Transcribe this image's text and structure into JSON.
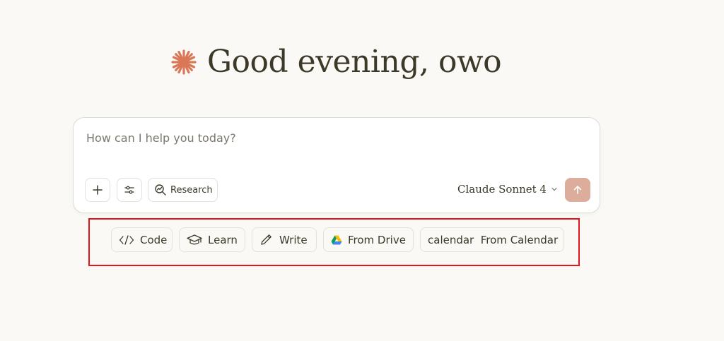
{
  "greeting": {
    "text": "Good evening, owo",
    "logo_icon": "asterisk-spark-icon",
    "logo_color": "#d97757"
  },
  "composer": {
    "placeholder": "How can I help you today?",
    "research_label": "Research",
    "model_name": "Claude Sonnet 4",
    "send_color": "#dcad9b"
  },
  "chips": [
    {
      "label": "Code",
      "icon": "code-icon"
    },
    {
      "label": "Learn",
      "icon": "graduation-cap-icon"
    },
    {
      "label": "Write",
      "icon": "pencil-icon"
    },
    {
      "label": "From Drive",
      "icon": "google-drive-icon"
    },
    {
      "label": "calendar  From Calendar",
      "icon": ""
    }
  ],
  "highlight_color": "#e2141e"
}
